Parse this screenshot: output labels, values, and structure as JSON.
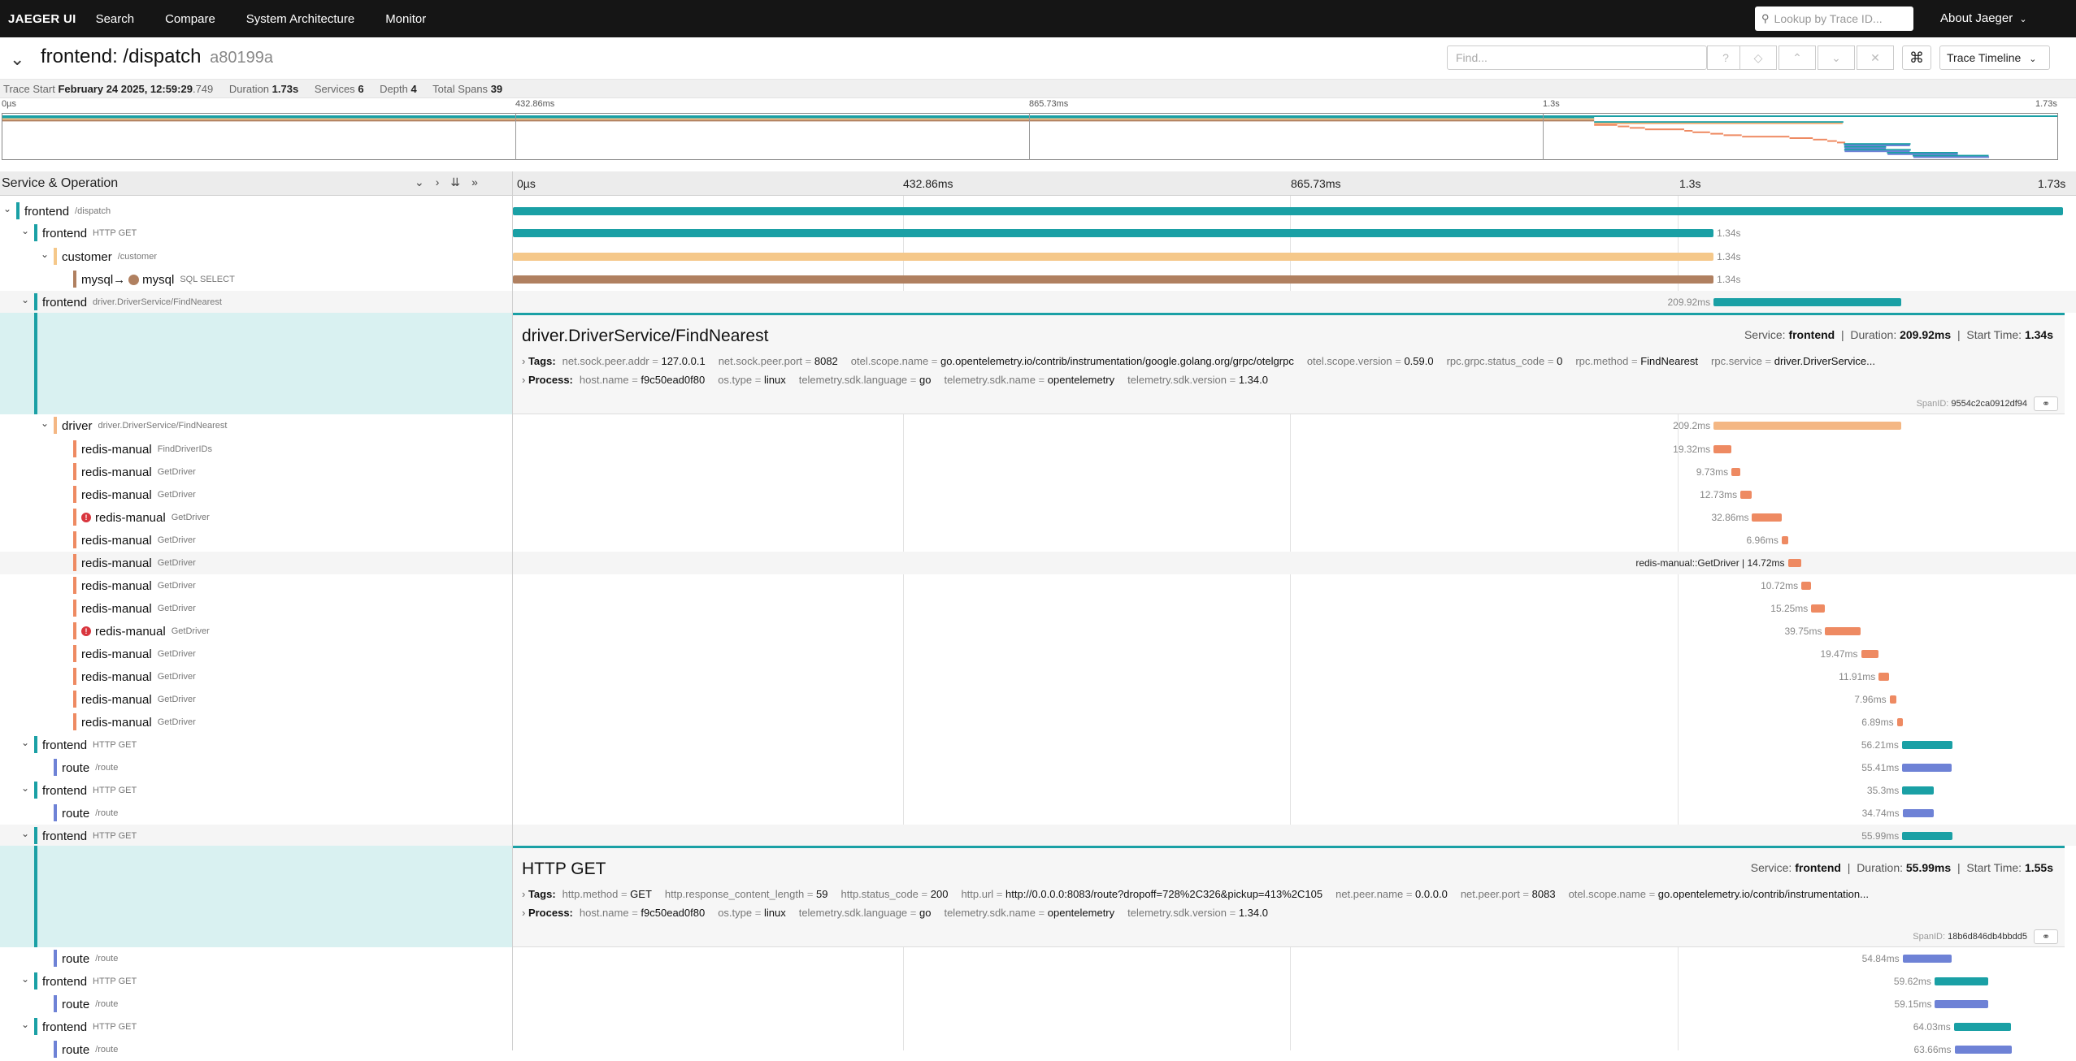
{
  "nav": {
    "brand": "JAEGER UI",
    "links": [
      "Search",
      "Compare",
      "System Architecture",
      "Monitor"
    ],
    "lookup_placeholder": "Lookup by Trace ID...",
    "about": "About Jaeger"
  },
  "trace": {
    "title": "frontend: /dispatch",
    "trace_id": "a80199a",
    "find_placeholder": "Find...",
    "view": "Trace Timeline",
    "start_label": "Trace Start",
    "start_value": "February 24 2025, 12:59:29",
    "start_ms": ".749",
    "duration_label": "Duration",
    "duration": "1.73s",
    "services_label": "Services",
    "services": "6",
    "depth_label": "Depth",
    "depth": "4",
    "total_spans_label": "Total Spans",
    "total_spans": "39"
  },
  "ticks": [
    "0µs",
    "432.86ms",
    "865.73ms",
    "1.3s",
    "1.73s"
  ],
  "header": {
    "service_operation": "Service & Operation"
  },
  "colors": {
    "frontend": "#1aa0a5",
    "customer": "#f5c88a",
    "mysql": "#b08060",
    "driver": "#f4b784",
    "redis": "#ee8a62",
    "route": "#6e82d6"
  },
  "rows": [
    {
      "svc": "frontend",
      "op": "/dispatch",
      "color": "#1aa0a5",
      "dur": "",
      "start": 0,
      "width": 1.0
    },
    {
      "svc": "frontend",
      "op": "HTTP GET",
      "color": "#1aa0a5",
      "dur": "1.34s",
      "start": 0,
      "width": 0.7746
    },
    {
      "svc": "customer",
      "op": "/customer",
      "color": "#f5c88a",
      "dur": "1.34s",
      "start": 0,
      "width": 0.7746
    },
    {
      "svc": "mysql",
      "svc2": "mysql",
      "op": "SQL SELECT",
      "color": "#b08060",
      "dur": "1.34s",
      "start": 0,
      "width": 0.7746
    },
    {
      "svc": "frontend",
      "op": "driver.DriverService/FindNearest",
      "color": "#1aa0a5",
      "dur": "209.92ms",
      "start": 0.7746,
      "width": 0.1213
    },
    {
      "svc": "driver",
      "op": "driver.DriverService/FindNearest",
      "color": "#f4b784",
      "dur": "209.2ms",
      "start": 0.7746,
      "width": 0.1209
    },
    {
      "svc": "redis-manual",
      "op": "FindDriverIDs",
      "color": "#ee8a62",
      "dur": "19.32ms",
      "start": 0.7746,
      "width": 0.0112
    },
    {
      "svc": "redis-manual",
      "op": "GetDriver",
      "color": "#ee8a62",
      "dur": "9.73ms",
      "start": 0.7861,
      "width": 0.0056
    },
    {
      "svc": "redis-manual",
      "op": "GetDriver",
      "color": "#ee8a62",
      "dur": "12.73ms",
      "start": 0.7919,
      "width": 0.0074
    },
    {
      "svc": "redis-manual",
      "op": "GetDriver",
      "color": "#ee8a62",
      "dur": "32.86ms",
      "start": 0.7994,
      "width": 0.019,
      "error": true
    },
    {
      "svc": "redis-manual",
      "op": "GetDriver",
      "color": "#ee8a62",
      "dur": "6.96ms",
      "start": 0.8185,
      "width": 0.004
    },
    {
      "svc": "redis-manual",
      "op": "GetDriver",
      "color": "#ee8a62",
      "dur": "redis-manual::GetDriver | 14.72ms",
      "start": 0.8225,
      "width": 0.0085
    },
    {
      "svc": "redis-manual",
      "op": "GetDriver",
      "color": "#ee8a62",
      "dur": "10.72ms",
      "start": 0.8312,
      "width": 0.0062
    },
    {
      "svc": "redis-manual",
      "op": "GetDriver",
      "color": "#ee8a62",
      "dur": "15.25ms",
      "start": 0.8376,
      "width": 0.0088
    },
    {
      "svc": "redis-manual",
      "op": "GetDriver",
      "color": "#ee8a62",
      "dur": "39.75ms",
      "start": 0.8466,
      "width": 0.023,
      "error": true
    },
    {
      "svc": "redis-manual",
      "op": "GetDriver",
      "color": "#ee8a62",
      "dur": "19.47ms",
      "start": 0.8697,
      "width": 0.0113
    },
    {
      "svc": "redis-manual",
      "op": "GetDriver",
      "color": "#ee8a62",
      "dur": "11.91ms",
      "start": 0.8811,
      "width": 0.0069
    },
    {
      "svc": "redis-manual",
      "op": "GetDriver",
      "color": "#ee8a62",
      "dur": "7.96ms",
      "start": 0.8881,
      "width": 0.0046
    },
    {
      "svc": "redis-manual",
      "op": "GetDriver",
      "color": "#ee8a62",
      "dur": "6.89ms",
      "start": 0.8928,
      "width": 0.004
    },
    {
      "svc": "frontend",
      "op": "HTTP GET",
      "color": "#1aa0a5",
      "dur": "56.21ms",
      "start": 0.8961,
      "width": 0.0325
    },
    {
      "svc": "route",
      "op": "/route",
      "color": "#6e82d6",
      "dur": "55.41ms",
      "start": 0.8963,
      "width": 0.032
    },
    {
      "svc": "frontend",
      "op": "HTTP GET",
      "color": "#1aa0a5",
      "dur": "35.3ms",
      "start": 0.8963,
      "width": 0.0204
    },
    {
      "svc": "route",
      "op": "/route",
      "color": "#6e82d6",
      "dur": "34.74ms",
      "start": 0.8965,
      "width": 0.0201
    },
    {
      "svc": "frontend",
      "op": "HTTP GET",
      "color": "#1aa0a5",
      "dur": "55.99ms",
      "start": 0.8963,
      "width": 0.0324
    },
    {
      "svc": "route",
      "op": "/route",
      "color": "#6e82d6",
      "dur": "54.84ms",
      "start": 0.8965,
      "width": 0.0317
    },
    {
      "svc": "frontend",
      "op": "HTTP GET",
      "color": "#1aa0a5",
      "dur": "59.62ms",
      "start": 0.9171,
      "width": 0.0345
    },
    {
      "svc": "route",
      "op": "/route",
      "color": "#6e82d6",
      "dur": "59.15ms",
      "start": 0.9174,
      "width": 0.0342
    },
    {
      "svc": "frontend",
      "op": "HTTP GET",
      "color": "#1aa0a5",
      "dur": "64.03ms",
      "start": 0.9296,
      "width": 0.037
    },
    {
      "svc": "route",
      "op": "/route",
      "color": "#6e82d6",
      "dur": "63.66ms",
      "start": 0.93,
      "width": 0.0368
    }
  ],
  "detail1": {
    "title": "driver.DriverService/FindNearest",
    "service_label": "Service:",
    "service": "frontend",
    "duration_label": "Duration:",
    "duration": "209.92ms",
    "start_label": "Start Time:",
    "start": "1.34s",
    "tags_label": "Tags:",
    "tags": [
      {
        "k": "net.sock.peer.addr",
        "v": "127.0.0.1"
      },
      {
        "k": "net.sock.peer.port",
        "v": "8082"
      },
      {
        "k": "otel.scope.name",
        "v": "go.opentelemetry.io/contrib/instrumentation/google.golang.org/grpc/otelgrpc"
      },
      {
        "k": "otel.scope.version",
        "v": "0.59.0"
      },
      {
        "k": "rpc.grpc.status_code",
        "v": "0"
      },
      {
        "k": "rpc.method",
        "v": "FindNearest"
      },
      {
        "k": "rpc.service",
        "v": "driver.DriverService..."
      }
    ],
    "process_label": "Process:",
    "process": [
      {
        "k": "host.name",
        "v": "f9c50ead0f80"
      },
      {
        "k": "os.type",
        "v": "linux"
      },
      {
        "k": "telemetry.sdk.language",
        "v": "go"
      },
      {
        "k": "telemetry.sdk.name",
        "v": "opentelemetry"
      },
      {
        "k": "telemetry.sdk.version",
        "v": "1.34.0"
      }
    ],
    "spanid_label": "SpanID:",
    "spanid": "9554c2ca0912df94"
  },
  "detail2": {
    "title": "HTTP GET",
    "service_label": "Service:",
    "service": "frontend",
    "duration_label": "Duration:",
    "duration": "55.99ms",
    "start_label": "Start Time:",
    "start": "1.55s",
    "tags_label": "Tags:",
    "tags": [
      {
        "k": "http.method",
        "v": "GET"
      },
      {
        "k": "http.response_content_length",
        "v": "59"
      },
      {
        "k": "http.status_code",
        "v": "200"
      },
      {
        "k": "http.url",
        "v": "http://0.0.0.0:8083/route?dropoff=728%2C326&pickup=413%2C105"
      },
      {
        "k": "net.peer.name",
        "v": "0.0.0.0"
      },
      {
        "k": "net.peer.port",
        "v": "8083"
      },
      {
        "k": "otel.scope.name",
        "v": "go.opentelemetry.io/contrib/instrumentation..."
      }
    ],
    "process_label": "Process:",
    "process": [
      {
        "k": "host.name",
        "v": "f9c50ead0f80"
      },
      {
        "k": "os.type",
        "v": "linux"
      },
      {
        "k": "telemetry.sdk.language",
        "v": "go"
      },
      {
        "k": "telemetry.sdk.name",
        "v": "opentelemetry"
      },
      {
        "k": "telemetry.sdk.version",
        "v": "1.34.0"
      }
    ],
    "spanid_label": "SpanID:",
    "spanid": "18b6d846db4bbdd5"
  }
}
